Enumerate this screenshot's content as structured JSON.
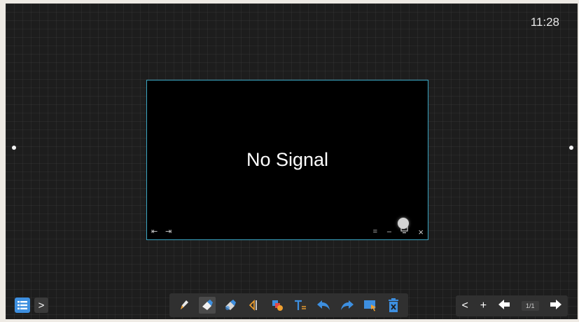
{
  "clock": "11:28",
  "window": {
    "message": "No Signal",
    "controls": {
      "prev": "⇤",
      "next": "⇥",
      "menu": "=",
      "minimize": "–",
      "close": "×"
    }
  },
  "left_panel": {
    "menu_icon": "list-icon",
    "expand": ">"
  },
  "toolbar": {
    "tools": [
      "pen-icon",
      "eraser-icon",
      "fill-eraser-icon",
      "mirror-shape-icon",
      "shapes-icon",
      "text-icon",
      "undo-icon",
      "redo-icon",
      "select-icon",
      "delete-icon"
    ],
    "active_tool": "eraser-icon",
    "accent": "#3d8fe0"
  },
  "pager": {
    "prev": "<",
    "add": "+",
    "page_count": "1/1"
  }
}
